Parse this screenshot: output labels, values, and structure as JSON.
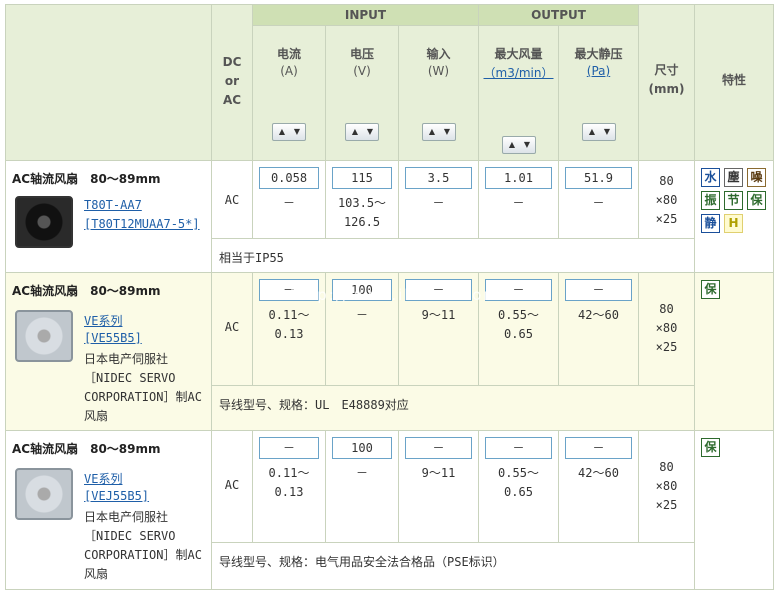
{
  "header": {
    "dcac": [
      "DC",
      "or",
      "AC"
    ],
    "group_input": "INPUT",
    "group_output": "OUTPUT",
    "columns": [
      {
        "label": "电流",
        "unit": "(A)"
      },
      {
        "label": "电压",
        "unit": "(V)"
      },
      {
        "label": "输入",
        "unit": "(W)"
      },
      {
        "label": "最大风量",
        "unit": "（m3/min）"
      },
      {
        "label": "最大静压",
        "unit": "(Pa)"
      }
    ],
    "size_label": "尺寸",
    "size_unit": "(mm)",
    "feature_label": "特性"
  },
  "products": [
    {
      "title": "AC轴流风扇　80～89mm",
      "image": "fan-dark-icon",
      "links": [
        "T80T-AA7",
        "[T80T12MUAA7-5*]"
      ],
      "desc": [],
      "dcac": "AC",
      "boxes": [
        "0.058",
        "115",
        "3.5",
        "1.01",
        "51.9"
      ],
      "values": [
        [
          "－"
        ],
        [
          "103.5～",
          "126.5"
        ],
        [
          "－"
        ],
        [
          "－"
        ],
        [
          "－"
        ]
      ],
      "size": [
        "80",
        "×80",
        "×25"
      ],
      "features": [
        {
          "char": "水",
          "color": "#1a4f9a",
          "bg": "#ffffff",
          "border": "#1a4f9a"
        },
        {
          "char": "塵",
          "color": "#333333",
          "bg": "#ffffff",
          "border": "#666666"
        },
        {
          "char": "噪",
          "color": "#5a3a10",
          "bg": "#ffffff",
          "border": "#8a6a30"
        },
        {
          "char": "振",
          "color": "#2d6a2d",
          "bg": "#ffffff",
          "border": "#2d6a2d"
        },
        {
          "char": "节",
          "color": "#2d6a2d",
          "bg": "#ffffff",
          "border": "#2d6a2d"
        },
        {
          "char": "保",
          "color": "#2d6a2d",
          "bg": "#ffffff",
          "border": "#2d6a2d"
        },
        {
          "char": "静",
          "color": "#1a4f9a",
          "bg": "#ffffff",
          "border": "#1a4f9a"
        },
        {
          "char": "H",
          "color": "#b0a000",
          "bg": "#fffbd0",
          "border": "#e0d070"
        }
      ],
      "note": "相当于IP55",
      "bg": "#ffffff"
    },
    {
      "title": "AC轴流风扇　80～89mm",
      "image": "fan-light-icon",
      "links": [
        "VE系列",
        "[VE55B5]"
      ],
      "desc": [
        "日本电产伺服社",
        "［NIDEC SERVO",
        "CORPORATION］制AC",
        "风扇"
      ],
      "dcac": "AC",
      "boxes": [
        "－",
        "100",
        "－",
        "－",
        "－"
      ],
      "values": [
        [
          "0.11～",
          "0.13"
        ],
        [
          "－"
        ],
        [
          "9～11"
        ],
        [
          "0.55～",
          "0.65"
        ],
        [
          "42～60"
        ]
      ],
      "size": [
        "80",
        "×80",
        "×25"
      ],
      "features": [
        {
          "char": "保",
          "color": "#2d6a2d",
          "bg": "#ffffff",
          "border": "#2d6a2d"
        }
      ],
      "note": "导线型号、规格：UL　E48889对应",
      "bg": "#fbfbe6",
      "watermark": "http://www.ikmall.com"
    },
    {
      "title": "AC轴流风扇　80～89mm",
      "image": "fan-light-icon",
      "links": [
        "VE系列",
        "[VEJ55B5]"
      ],
      "desc": [
        "日本电产伺服社",
        "［NIDEC SERVO",
        "CORPORATION］制AC",
        "风扇"
      ],
      "dcac": "AC",
      "boxes": [
        "－",
        "100",
        "－",
        "－",
        "－"
      ],
      "values": [
        [
          "0.11～",
          "0.13"
        ],
        [
          "－"
        ],
        [
          "9～11"
        ],
        [
          "0.55～",
          "0.65"
        ],
        [
          "42～60"
        ]
      ],
      "size": [
        "80",
        "×80",
        "×25"
      ],
      "features": [
        {
          "char": "保",
          "color": "#2d6a2d",
          "bg": "#ffffff",
          "border": "#2d6a2d"
        }
      ],
      "note": "导线型号、规格：电气用品安全法合格品（PSE标识）",
      "bg": "#ffffff"
    }
  ]
}
